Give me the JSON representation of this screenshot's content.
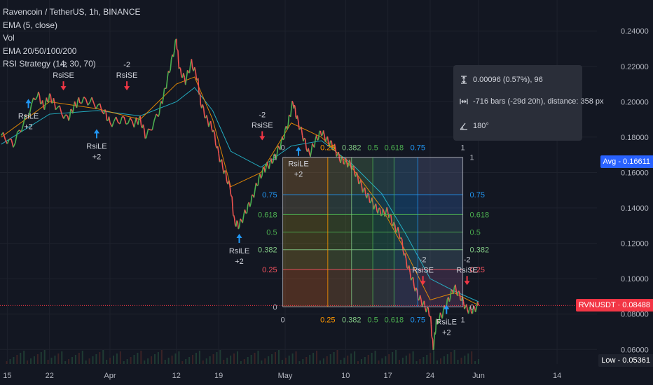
{
  "legend": {
    "symbol": "Ravencoin / TetherUS, 1h, BINANCE",
    "indicators": [
      "EMA (5, close)",
      "Vol",
      "EMA 20/50/100/200",
      "RSI Strategy (14, 30, 70)"
    ]
  },
  "tooltip": {
    "price_range": "0.00096 (0.57%), 96",
    "bar_range": "-716 bars (-29d 20h), distance: 358 px",
    "angle": "180°"
  },
  "price_tags": {
    "avg": "Avg - 0.16611",
    "current": "RVNUSDT · 0.08488",
    "low": "Low - 0.05361"
  },
  "colors": {
    "background": "#131722",
    "up": "#4caf50",
    "down": "#ef5350",
    "avg_tag": "#2962ff",
    "current_tag": "#f23645",
    "low_tag": "#1e222d",
    "long_signal": "#2196f3",
    "short_signal": "#f23645"
  },
  "chart_data": {
    "type": "line",
    "title": "Ravencoin / TetherUS, 1h, BINANCE",
    "y_ticks": [
      0.06,
      0.08,
      0.1,
      0.12,
      0.14,
      0.16,
      0.18,
      0.2,
      0.22,
      0.24
    ],
    "y_tick_labels": [
      "0.06000",
      "0.08000",
      "0.10000",
      "0.12000",
      "0.14000",
      "0.16000",
      "0.18000",
      "0.20000",
      "0.22000",
      "0.24000"
    ],
    "ylim": [
      0.0518,
      0.2575
    ],
    "x_tick_labels": [
      "15",
      "22",
      "Apr",
      "12",
      "19",
      "May",
      "10",
      "17",
      "24",
      "Jun",
      "14"
    ],
    "x_ticks_day": [
      0,
      7,
      17,
      28,
      35,
      46,
      56,
      63,
      70,
      78,
      91
    ],
    "xlim_day": [
      -1.2,
      97.6
    ],
    "price_path": [
      {
        "day": -1,
        "price": 0.181
      },
      {
        "day": 1,
        "price": 0.176
      },
      {
        "day": 3,
        "price": 0.19
      },
      {
        "day": 5,
        "price": 0.205
      },
      {
        "day": 6,
        "price": 0.197
      },
      {
        "day": 7,
        "price": 0.203
      },
      {
        "day": 8,
        "price": 0.198
      },
      {
        "day": 10,
        "price": 0.19
      },
      {
        "day": 11,
        "price": 0.197
      },
      {
        "day": 12,
        "price": 0.201
      },
      {
        "day": 14,
        "price": 0.2
      },
      {
        "day": 16,
        "price": 0.195
      },
      {
        "day": 17,
        "price": 0.188
      },
      {
        "day": 19,
        "price": 0.19
      },
      {
        "day": 21,
        "price": 0.188
      },
      {
        "day": 22,
        "price": 0.19
      },
      {
        "day": 23,
        "price": 0.18
      },
      {
        "day": 25,
        "price": 0.193
      },
      {
        "day": 26,
        "price": 0.205
      },
      {
        "day": 27,
        "price": 0.22
      },
      {
        "day": 28,
        "price": 0.235
      },
      {
        "day": 28.5,
        "price": 0.218
      },
      {
        "day": 29.5,
        "price": 0.212
      },
      {
        "day": 30.5,
        "price": 0.222
      },
      {
        "day": 31.5,
        "price": 0.213
      },
      {
        "day": 32,
        "price": 0.2
      },
      {
        "day": 33,
        "price": 0.19
      },
      {
        "day": 34,
        "price": 0.185
      },
      {
        "day": 35,
        "price": 0.17
      },
      {
        "day": 36,
        "price": 0.16
      },
      {
        "day": 37,
        "price": 0.15
      },
      {
        "day": 37.6,
        "price": 0.132
      },
      {
        "day": 38.4,
        "price": 0.13
      },
      {
        "day": 39.5,
        "price": 0.138
      },
      {
        "day": 40.5,
        "price": 0.145
      },
      {
        "day": 41.5,
        "price": 0.155
      },
      {
        "day": 42.5,
        "price": 0.162
      },
      {
        "day": 43.5,
        "price": 0.165
      },
      {
        "day": 44.5,
        "price": 0.17
      },
      {
        "day": 45.5,
        "price": 0.178
      },
      {
        "day": 46.5,
        "price": 0.188
      },
      {
        "day": 47.3,
        "price": 0.2
      },
      {
        "day": 48,
        "price": 0.19
      },
      {
        "day": 49,
        "price": 0.18
      },
      {
        "day": 50,
        "price": 0.17
      },
      {
        "day": 51,
        "price": 0.178
      },
      {
        "day": 52,
        "price": 0.183
      },
      {
        "day": 53,
        "price": 0.178
      },
      {
        "day": 54,
        "price": 0.175
      },
      {
        "day": 55,
        "price": 0.168
      },
      {
        "day": 56,
        "price": 0.166
      },
      {
        "day": 57,
        "price": 0.164
      },
      {
        "day": 58,
        "price": 0.157
      },
      {
        "day": 59,
        "price": 0.15
      },
      {
        "day": 60,
        "price": 0.145
      },
      {
        "day": 61,
        "price": 0.14
      },
      {
        "day": 62,
        "price": 0.137
      },
      {
        "day": 63,
        "price": 0.138
      },
      {
        "day": 64,
        "price": 0.13
      },
      {
        "day": 65,
        "price": 0.125
      },
      {
        "day": 66,
        "price": 0.11
      },
      {
        "day": 67,
        "price": 0.1
      },
      {
        "day": 68,
        "price": 0.09
      },
      {
        "day": 69,
        "price": 0.085
      },
      {
        "day": 70,
        "price": 0.08
      },
      {
        "day": 70.5,
        "price": 0.06
      },
      {
        "day": 71,
        "price": 0.075
      },
      {
        "day": 72,
        "price": 0.08
      },
      {
        "day": 73,
        "price": 0.088
      },
      {
        "day": 74,
        "price": 0.095
      },
      {
        "day": 75,
        "price": 0.09
      },
      {
        "day": 76,
        "price": 0.083
      },
      {
        "day": 77,
        "price": 0.082
      },
      {
        "day": 78,
        "price": 0.085
      }
    ],
    "ema_paths": [
      {
        "color": "#26c6da",
        "points": [
          {
            "day": -1,
            "price": 0.176
          },
          {
            "day": 7,
            "price": 0.193
          },
          {
            "day": 15,
            "price": 0.195
          },
          {
            "day": 22,
            "price": 0.192
          },
          {
            "day": 28,
            "price": 0.2
          },
          {
            "day": 31,
            "price": 0.208
          },
          {
            "day": 34,
            "price": 0.195
          },
          {
            "day": 37,
            "price": 0.172
          },
          {
            "day": 42,
            "price": 0.163
          },
          {
            "day": 47,
            "price": 0.175
          },
          {
            "day": 52,
            "price": 0.178
          },
          {
            "day": 57,
            "price": 0.165
          },
          {
            "day": 62,
            "price": 0.148
          },
          {
            "day": 66,
            "price": 0.125
          },
          {
            "day": 70,
            "price": 0.1
          },
          {
            "day": 74,
            "price": 0.093
          },
          {
            "day": 78,
            "price": 0.087
          }
        ]
      },
      {
        "color": "#ff9800",
        "points": [
          {
            "day": -1,
            "price": 0.18
          },
          {
            "day": 7,
            "price": 0.2
          },
          {
            "day": 15,
            "price": 0.196
          },
          {
            "day": 22,
            "price": 0.19
          },
          {
            "day": 28,
            "price": 0.21
          },
          {
            "day": 31,
            "price": 0.214
          },
          {
            "day": 34,
            "price": 0.19
          },
          {
            "day": 37,
            "price": 0.152
          },
          {
            "day": 42,
            "price": 0.16
          },
          {
            "day": 47,
            "price": 0.188
          },
          {
            "day": 52,
            "price": 0.18
          },
          {
            "day": 57,
            "price": 0.163
          },
          {
            "day": 62,
            "price": 0.14
          },
          {
            "day": 66,
            "price": 0.115
          },
          {
            "day": 70,
            "price": 0.088
          },
          {
            "day": 74,
            "price": 0.092
          },
          {
            "day": 78,
            "price": 0.085
          }
        ]
      }
    ],
    "annotations": [
      {
        "day": 3.5,
        "price": 0.2016,
        "label": "RsiLE",
        "value": "+2",
        "side": "long"
      },
      {
        "day": 14.8,
        "price": 0.1845,
        "label": "RsiLE",
        "value": "+2",
        "side": "long"
      },
      {
        "day": 38.4,
        "price": 0.1254,
        "label": "RsiLE",
        "value": "+2",
        "side": "long"
      },
      {
        "day": 48.2,
        "price": 0.1746,
        "label": "RsiLE",
        "value": "+2",
        "side": "long"
      },
      {
        "day": 72.7,
        "price": 0.0852,
        "label": "RsiLE",
        "value": "+2",
        "side": "long"
      },
      {
        "day": 9.3,
        "price": 0.2064,
        "label": "RsiSE",
        "value": "-2",
        "side": "short"
      },
      {
        "day": 19.8,
        "price": 0.2064,
        "label": "RsiSE",
        "value": "-2",
        "side": "short"
      },
      {
        "day": 42.2,
        "price": 0.1782,
        "label": "RsiSE",
        "value": "-2",
        "side": "short"
      },
      {
        "day": 68.8,
        "price": 0.0964,
        "label": "RsiSE",
        "value": "-2",
        "side": "short"
      },
      {
        "day": 76.1,
        "price": 0.0964,
        "label": "RsiSE",
        "value": "-2",
        "side": "short"
      }
    ],
    "fib_levels": [
      {
        "level": 1,
        "label": "1",
        "color": "#b2b5be"
      },
      {
        "level": 0.75,
        "label": "0.75",
        "color": "#2196f3"
      },
      {
        "level": 0.618,
        "label": "0.618",
        "color": "#4caf50"
      },
      {
        "level": 0.5,
        "label": "0.5",
        "color": "#4caf50"
      },
      {
        "level": 0.382,
        "label": "0.382",
        "color": "#81c784"
      },
      {
        "level": 0.25,
        "label": "0.25",
        "color": "#f7525f"
      },
      {
        "level": 0,
        "label": "0",
        "color": "#b2b5be"
      }
    ],
    "fib_time_levels": [
      {
        "level": 0,
        "label": "0",
        "color": "#b2b5be"
      },
      {
        "level": 0.25,
        "label": "0.25",
        "color": "#ff9800"
      },
      {
        "level": 0.382,
        "label": "0.382",
        "color": "#81c784"
      },
      {
        "level": 0.5,
        "label": "0.5",
        "color": "#4caf50"
      },
      {
        "level": 0.618,
        "label": "0.618",
        "color": "#4caf50"
      },
      {
        "level": 0.75,
        "label": "0.75",
        "color": "#2196f3"
      },
      {
        "level": 1,
        "label": "1",
        "color": "#b2b5be"
      }
    ],
    "fib_box": {
      "day_start": 45.6,
      "day_end": 75.4,
      "price_top": 0.1686,
      "price_bottom": 0.0841
    },
    "current_price": 0.08488,
    "avg_price": 0.16611,
    "low_price": 0.05361
  }
}
